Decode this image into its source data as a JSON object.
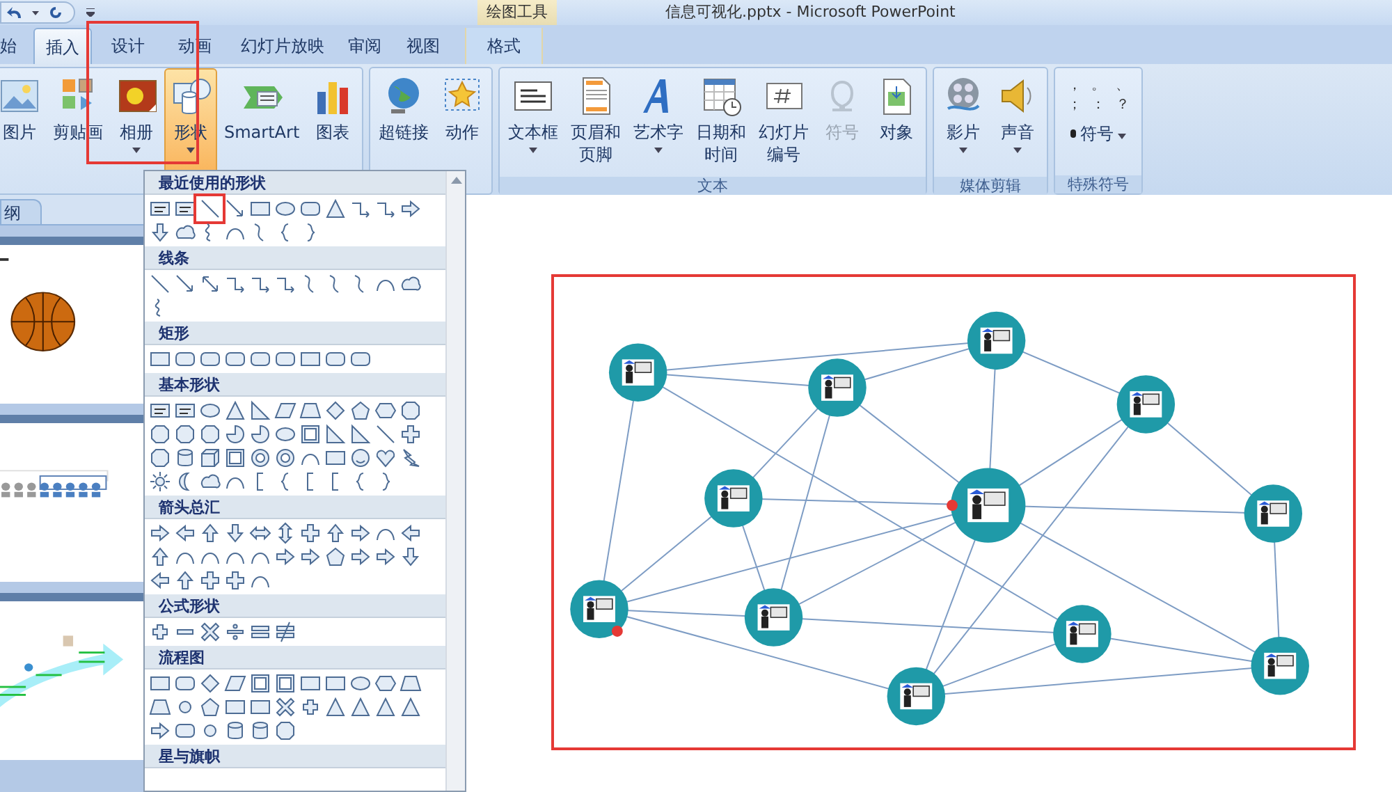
{
  "window": {
    "title": "信息可视化.pptx - Microsoft PowerPoint",
    "context_group": "绘图工具"
  },
  "tabs": [
    {
      "label": "始",
      "selected": false,
      "contextual": false
    },
    {
      "label": "插入",
      "selected": true,
      "contextual": false
    },
    {
      "label": "设计",
      "selected": false,
      "contextual": false
    },
    {
      "label": "动画",
      "selected": false,
      "contextual": false
    },
    {
      "label": "幻灯片放映",
      "selected": false,
      "contextual": false
    },
    {
      "label": "审阅",
      "selected": false,
      "contextual": false
    },
    {
      "label": "视图",
      "selected": false,
      "contextual": false
    },
    {
      "label": "格式",
      "selected": false,
      "contextual": true
    }
  ],
  "ribbon": {
    "annotated": true,
    "groups": [
      {
        "buttons": [
          {
            "kind": "picture",
            "lines": [
              "图片"
            ],
            "dropdown": false,
            "selected": false,
            "disabled": false
          },
          {
            "kind": "clipart",
            "lines": [
              "剪贴画"
            ],
            "dropdown": false,
            "selected": false,
            "disabled": false
          },
          {
            "kind": "album",
            "lines": [
              "相册"
            ],
            "dropdown": true,
            "selected": false,
            "disabled": false
          },
          {
            "kind": "shapes",
            "lines": [
              "形状"
            ],
            "dropdown": true,
            "selected": true,
            "disabled": false
          },
          {
            "kind": "smartart",
            "lines": [
              "SmartArt"
            ],
            "dropdown": false,
            "selected": false,
            "disabled": false
          },
          {
            "kind": "chart",
            "lines": [
              "图表"
            ],
            "dropdown": false,
            "selected": false,
            "disabled": false
          }
        ]
      },
      {
        "buttons": [
          {
            "kind": "hyperlink",
            "lines": [
              "超链接"
            ],
            "dropdown": false,
            "selected": false,
            "disabled": false
          },
          {
            "kind": "action",
            "lines": [
              "动作"
            ],
            "dropdown": false,
            "selected": false,
            "disabled": false
          }
        ]
      },
      {
        "label": "文本",
        "buttons": [
          {
            "kind": "textbox",
            "lines": [
              "文本框"
            ],
            "dropdown": true,
            "selected": false,
            "disabled": false
          },
          {
            "kind": "header",
            "lines": [
              "页眉和",
              "页脚"
            ],
            "dropdown": false,
            "selected": false,
            "disabled": false
          },
          {
            "kind": "wordart",
            "lines": [
              "艺术字"
            ],
            "dropdown": true,
            "selected": false,
            "disabled": false
          },
          {
            "kind": "datetime",
            "lines": [
              "日期和",
              "时间"
            ],
            "dropdown": false,
            "selected": false,
            "disabled": false
          },
          {
            "kind": "slidenumber",
            "lines": [
              "幻灯片",
              "编号"
            ],
            "dropdown": false,
            "selected": false,
            "disabled": false
          },
          {
            "kind": "symbol",
            "lines": [
              "符号"
            ],
            "dropdown": false,
            "selected": false,
            "disabled": true
          },
          {
            "kind": "object",
            "lines": [
              "对象"
            ],
            "dropdown": false,
            "selected": false,
            "disabled": false
          }
        ]
      },
      {
        "label": "媒体剪辑",
        "buttons": [
          {
            "kind": "movie",
            "lines": [
              "影片"
            ],
            "dropdown": true,
            "selected": false,
            "disabled": false
          },
          {
            "kind": "sound",
            "lines": [
              "声音"
            ],
            "dropdown": true,
            "selected": false,
            "disabled": false
          }
        ]
      }
    ],
    "special": {
      "label": "特殊符号",
      "marks": [
        "，",
        "。",
        "、",
        "；",
        "：",
        "？"
      ],
      "button": "符号"
    }
  },
  "gallery": {
    "sections": [
      {
        "title": "最近使用的形状",
        "shapes": [
          {
            "kind": "textbox",
            "annotated": false
          },
          {
            "kind": "textbox",
            "annotated": false
          },
          {
            "kind": "line",
            "annotated": true
          },
          {
            "kind": "arrow",
            "annotated": false
          },
          {
            "kind": "rect",
            "annotated": false
          },
          {
            "kind": "ellipse",
            "annotated": false
          },
          {
            "kind": "round-rect",
            "annotated": false
          },
          {
            "kind": "triangle",
            "annotated": false
          },
          {
            "kind": "elbow",
            "annotated": false
          },
          {
            "kind": "elbow",
            "annotated": false
          },
          {
            "kind": "arrow-right",
            "annotated": false
          },
          {
            "kind": "arrow-down",
            "annotated": false
          },
          {
            "kind": "cloud",
            "annotated": false
          },
          {
            "kind": "scribble",
            "annotated": false
          },
          {
            "kind": "arc",
            "annotated": false
          },
          {
            "kind": "curve",
            "annotated": false
          },
          {
            "kind": "brace-l",
            "annotated": false
          },
          {
            "kind": "brace-r",
            "annotated": false
          }
        ]
      },
      {
        "title": "线条",
        "shapes": [
          {
            "kind": "line"
          },
          {
            "kind": "arrow"
          },
          {
            "kind": "dbl-arrow"
          },
          {
            "kind": "elbow"
          },
          {
            "kind": "elbow"
          },
          {
            "kind": "elbow"
          },
          {
            "kind": "curve"
          },
          {
            "kind": "curve"
          },
          {
            "kind": "curve"
          },
          {
            "kind": "arc"
          },
          {
            "kind": "cloud"
          },
          {
            "kind": "scribble"
          }
        ]
      },
      {
        "title": "矩形",
        "shapes": [
          {
            "kind": "rect"
          },
          {
            "kind": "round-rect"
          },
          {
            "kind": "round-rect"
          },
          {
            "kind": "round-rect"
          },
          {
            "kind": "round-rect"
          },
          {
            "kind": "round-rect"
          },
          {
            "kind": "rect"
          },
          {
            "kind": "round-rect"
          },
          {
            "kind": "round-rect"
          }
        ]
      },
      {
        "title": "基本形状",
        "shapes": [
          {
            "kind": "textbox"
          },
          {
            "kind": "textbox"
          },
          {
            "kind": "ellipse"
          },
          {
            "kind": "triangle"
          },
          {
            "kind": "rtriangle"
          },
          {
            "kind": "parallelogram"
          },
          {
            "kind": "trapezoid"
          },
          {
            "kind": "diamond"
          },
          {
            "kind": "pentagon"
          },
          {
            "kind": "hexagon"
          },
          {
            "kind": "octagon"
          },
          {
            "kind": "octagon"
          },
          {
            "kind": "octagon"
          },
          {
            "kind": "octagon"
          },
          {
            "kind": "pie"
          },
          {
            "kind": "pie"
          },
          {
            "kind": "ellipse"
          },
          {
            "kind": "frame"
          },
          {
            "kind": "rtriangle"
          },
          {
            "kind": "rtriangle"
          },
          {
            "kind": "line"
          },
          {
            "kind": "cross"
          },
          {
            "kind": "octagon"
          },
          {
            "kind": "cylinder"
          },
          {
            "kind": "cube"
          },
          {
            "kind": "frame"
          },
          {
            "kind": "donut"
          },
          {
            "kind": "donut"
          },
          {
            "kind": "arc"
          },
          {
            "kind": "rect"
          },
          {
            "kind": "smiley"
          },
          {
            "kind": "heart"
          },
          {
            "kind": "lightning"
          },
          {
            "kind": "sun"
          },
          {
            "kind": "moon"
          },
          {
            "kind": "cloud"
          },
          {
            "kind": "arc"
          },
          {
            "kind": "bracket"
          },
          {
            "kind": "brace-l"
          },
          {
            "kind": "bracket"
          },
          {
            "kind": "bracket"
          },
          {
            "kind": "brace-l"
          },
          {
            "kind": "brace-r"
          }
        ]
      },
      {
        "title": "箭头总汇",
        "shapes": [
          {
            "kind": "arrow-right"
          },
          {
            "kind": "arrow-left"
          },
          {
            "kind": "arrow-up"
          },
          {
            "kind": "arrow-down"
          },
          {
            "kind": "arrow-lr"
          },
          {
            "kind": "arrow-ud"
          },
          {
            "kind": "cross"
          },
          {
            "kind": "arrow-up"
          },
          {
            "kind": "arrow-right"
          },
          {
            "kind": "arc"
          },
          {
            "kind": "arrow-left"
          },
          {
            "kind": "arrow-up"
          },
          {
            "kind": "arc"
          },
          {
            "kind": "arc"
          },
          {
            "kind": "arc"
          },
          {
            "kind": "arc"
          },
          {
            "kind": "arrow-right"
          },
          {
            "kind": "arrow-right"
          },
          {
            "kind": "pentagon"
          },
          {
            "kind": "arrow-right"
          },
          {
            "kind": "arrow-right"
          },
          {
            "kind": "arrow-down"
          },
          {
            "kind": "arrow-left"
          },
          {
            "kind": "arrow-up"
          },
          {
            "kind": "cross"
          },
          {
            "kind": "cross"
          },
          {
            "kind": "arc"
          }
        ]
      },
      {
        "title": "公式形状",
        "shapes": [
          {
            "kind": "plus"
          },
          {
            "kind": "minus"
          },
          {
            "kind": "times"
          },
          {
            "kind": "divide"
          },
          {
            "kind": "equal"
          },
          {
            "kind": "notequal"
          }
        ]
      },
      {
        "title": "流程图",
        "shapes": [
          {
            "kind": "rect"
          },
          {
            "kind": "round-rect"
          },
          {
            "kind": "diamond"
          },
          {
            "kind": "parallelogram"
          },
          {
            "kind": "frame"
          },
          {
            "kind": "frame"
          },
          {
            "kind": "rect"
          },
          {
            "kind": "rect"
          },
          {
            "kind": "ellipse"
          },
          {
            "kind": "hexagon"
          },
          {
            "kind": "trapezoid"
          },
          {
            "kind": "trapezoid"
          },
          {
            "kind": "circle"
          },
          {
            "kind": "pentagon"
          },
          {
            "kind": "rect"
          },
          {
            "kind": "rect"
          },
          {
            "kind": "times"
          },
          {
            "kind": "plus"
          },
          {
            "kind": "triangle"
          },
          {
            "kind": "triangle"
          },
          {
            "kind": "triangle"
          },
          {
            "kind": "triangle"
          },
          {
            "kind": "arrow-right"
          },
          {
            "kind": "round-rect"
          },
          {
            "kind": "circle"
          },
          {
            "kind": "cylinder"
          },
          {
            "kind": "cylinder"
          },
          {
            "kind": "octagon"
          }
        ]
      },
      {
        "title": "星与旗帜"
      }
    ]
  },
  "slides_pane": {
    "tab": "纲",
    "thumbnails": [
      {
        "kind": "basketball"
      },
      {
        "kind": "people"
      },
      {
        "kind": "arrow"
      }
    ]
  },
  "slide": {
    "kind": "network",
    "annotated": true
  }
}
